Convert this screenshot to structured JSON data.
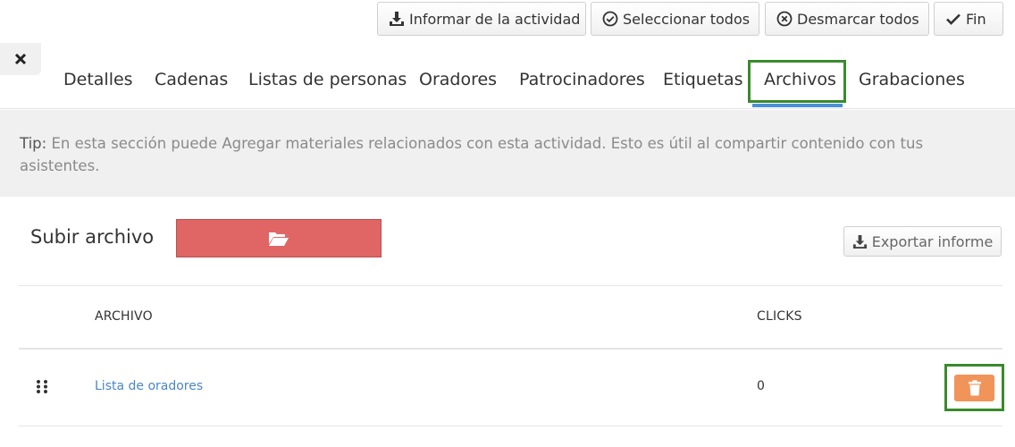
{
  "toolbar": {
    "report_label": "Informar de la actividad",
    "select_all_label": "Seleccionar todos",
    "deselect_all_label": "Desmarcar todos",
    "finish_label": "Fin"
  },
  "tabs": [
    {
      "label": "Detalles"
    },
    {
      "label": "Cadenas"
    },
    {
      "label": "Listas de personas"
    },
    {
      "label": "Oradores"
    },
    {
      "label": "Patrocinadores"
    },
    {
      "label": "Etiquetas"
    },
    {
      "label": "Archivos",
      "active": true
    },
    {
      "label": "Grabaciones"
    }
  ],
  "tip": {
    "label": "Tip:",
    "text": "En esta sección puede Agregar materiales relacionados con esta actividad. Esto es útil al compartir contenido con tus asistentes."
  },
  "upload": {
    "label": "Subir archivo",
    "icon": "folder-open-icon"
  },
  "export": {
    "label": "Exportar informe",
    "icon": "download-icon"
  },
  "table": {
    "headers": {
      "file": "ARCHIVO",
      "clicks": "CLICKS"
    },
    "rows": [
      {
        "file": "Lista de oradores",
        "clicks": "0"
      }
    ]
  },
  "colors": {
    "upload_button": "#e06666",
    "delete_button": "#f0945a",
    "link": "#4a86c8",
    "active_tab_underline": "#4a90d9",
    "highlight_frame": "#3a8a2c"
  }
}
